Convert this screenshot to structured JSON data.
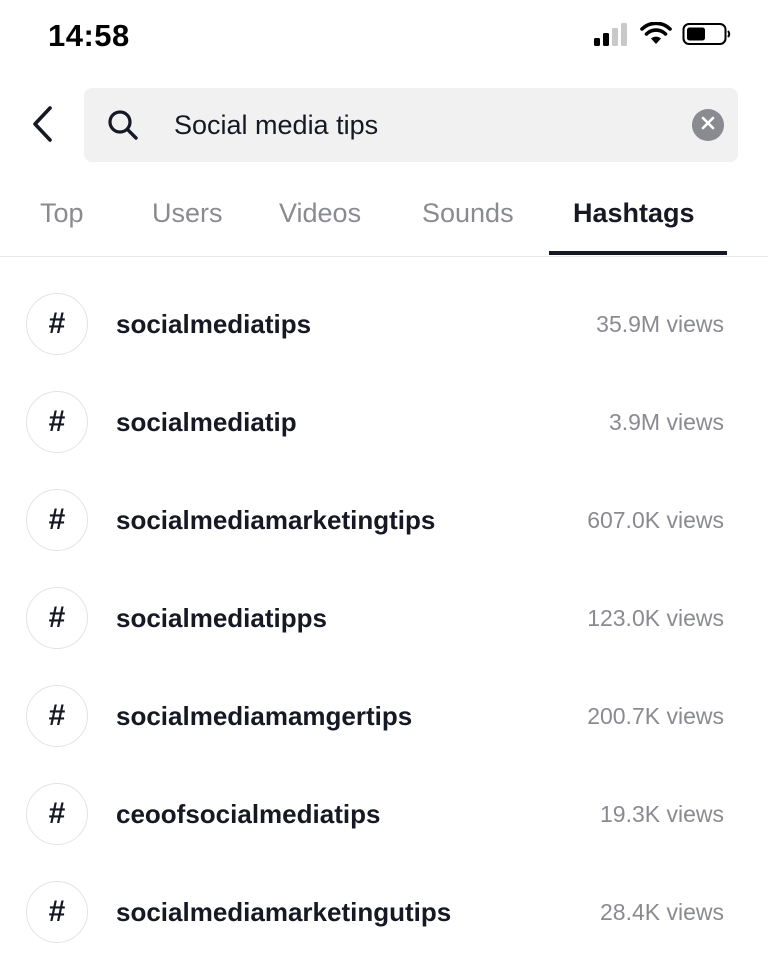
{
  "status_bar": {
    "time": "14:58",
    "icons": [
      "cellular-signal-icon",
      "wifi-icon",
      "battery-icon"
    ]
  },
  "search": {
    "value": "Social media tips",
    "icon": "search-icon",
    "clear_icon": "clear-icon",
    "back_icon": "chevron-left-icon"
  },
  "tabs": [
    {
      "label": "Top",
      "active": false
    },
    {
      "label": "Users",
      "active": false
    },
    {
      "label": "Videos",
      "active": false
    },
    {
      "label": "Sounds",
      "active": false
    },
    {
      "label": "Hashtags",
      "active": true
    }
  ],
  "hashtags": [
    {
      "symbol": "#",
      "name": "socialmediatips",
      "views": "35.9M views"
    },
    {
      "symbol": "#",
      "name": "socialmediatip",
      "views": "3.9M views"
    },
    {
      "symbol": "#",
      "name": "socialmediamarketingtips",
      "views": "607.0K views"
    },
    {
      "symbol": "#",
      "name": "socialmediatipps",
      "views": "123.0K views"
    },
    {
      "symbol": "#",
      "name": "socialmediamamgertips",
      "views": "200.7K views"
    },
    {
      "symbol": "#",
      "name": "ceoofsocialmediatips",
      "views": "19.3K views"
    },
    {
      "symbol": "#",
      "name": "socialmediamarketingutips",
      "views": "28.4K views"
    }
  ],
  "colors": {
    "text_primary": "#161823",
    "text_secondary": "#8a8b91",
    "search_background": "#f1f1f2",
    "divider": "#e6e6e8"
  }
}
